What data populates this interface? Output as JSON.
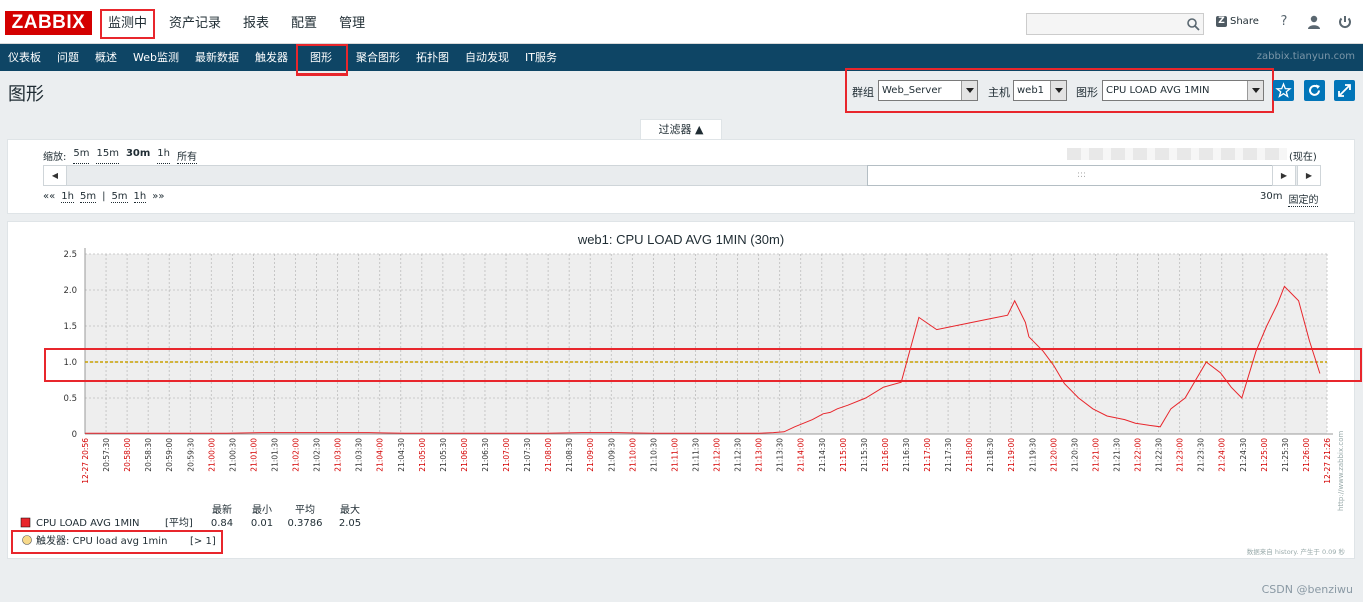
{
  "logo": "ZABBIX",
  "main_menu": [
    "监测中",
    "资产记录",
    "报表",
    "配置",
    "管理"
  ],
  "header_right": {
    "share": "Share",
    "help": "?"
  },
  "sub_menu": [
    "仪表板",
    "问题",
    "概述",
    "Web监测",
    "最新数据",
    "触发器",
    "图形",
    "聚合图形",
    "拓扑图",
    "自动发现",
    "IT服务"
  ],
  "domain": "zabbix.tianyun.com",
  "page_title": "图形",
  "selectors": {
    "group_label": "群组",
    "group_value": "Web_Server",
    "host_label": "主机",
    "host_value": "web1",
    "graph_label": "图形",
    "graph_value": "CPU LOAD AVG 1MIN"
  },
  "filter": {
    "toggle": "过滤器 ▲",
    "zoom_label": "缩放:",
    "zoom_options": [
      "5m",
      "15m",
      "30m",
      "1h",
      "所有"
    ],
    "zoom_active": "30m",
    "now": "(现在)",
    "nav_left": [
      "««",
      "1h",
      "5m",
      "|",
      "5m",
      "1h",
      "»»"
    ],
    "period": "30m",
    "fixed": "固定的"
  },
  "graph": {
    "title": "web1: CPU LOAD AVG 1MIN (30m)",
    "side_label": "http://www.zabbix.com",
    "footer_note": "数据来自 history. 产生于 0.09 秒"
  },
  "legend": {
    "headers": [
      "最新",
      "最小",
      "平均",
      "最大"
    ],
    "item_name": "CPU LOAD AVG 1MIN",
    "item_func": "[平均]",
    "item_values": [
      "0.84",
      "0.01",
      "0.3786",
      "2.05"
    ],
    "trigger_name": "触发器: CPU load avg 1min",
    "trigger_cond": "[> 1]"
  },
  "watermark": "CSDN @benziwu",
  "colors": {
    "series": "#e8262c",
    "trigger": "#c8a000",
    "accent": "#0275b8",
    "nav": "#0e4565",
    "highlight": "#e8262c"
  },
  "chart_data": {
    "type": "line",
    "title": "web1: CPU LOAD AVG 1MIN (30m)",
    "ylim": [
      0,
      2.5
    ],
    "y_ticks": [
      "0",
      "0.5",
      "1.0",
      "1.5",
      "2.0",
      "2.5"
    ],
    "x_ticks": [
      "12-27 20:56",
      "20:57:30",
      "20:58:00",
      "20:58:30",
      "20:59:00",
      "20:59:30",
      "21:00:00",
      "21:00:30",
      "21:01:00",
      "21:01:30",
      "21:02:00",
      "21:02:30",
      "21:03:00",
      "21:03:30",
      "21:04:00",
      "21:04:30",
      "21:05:00",
      "21:05:30",
      "21:06:00",
      "21:06:30",
      "21:07:00",
      "21:07:30",
      "21:08:00",
      "21:08:30",
      "21:09:00",
      "21:09:30",
      "21:10:00",
      "21:10:30",
      "21:11:00",
      "21:11:30",
      "21:12:00",
      "21:12:30",
      "21:13:00",
      "21:13:30",
      "21:14:00",
      "21:14:30",
      "21:15:00",
      "21:15:30",
      "21:16:00",
      "21:16:30",
      "21:17:00",
      "21:17:30",
      "21:18:00",
      "21:18:30",
      "21:19:00",
      "21:19:30",
      "21:20:00",
      "21:20:30",
      "21:21:00",
      "21:21:30",
      "21:22:00",
      "21:22:30",
      "21:23:00",
      "21:23:30",
      "21:24:00",
      "21:24:30",
      "21:25:00",
      "21:25:30",
      "21:26:00",
      "12-27 21:26"
    ],
    "x_ticks_red": [
      0,
      2,
      6,
      8,
      10,
      12,
      14,
      16,
      18,
      20,
      22,
      24,
      26,
      28,
      30,
      32,
      34,
      36,
      38,
      40,
      42,
      44,
      46,
      48,
      50,
      52,
      54,
      56,
      58,
      59
    ],
    "x_minutes": [
      0,
      1,
      2,
      3,
      4,
      5,
      6,
      7,
      8,
      9,
      10,
      11,
      12,
      13,
      14,
      15,
      16,
      17,
      18,
      19,
      19.4,
      19.7,
      20,
      20.5,
      20.8,
      21,
      21.2,
      21.5,
      22,
      22.5,
      23,
      23.5,
      24,
      24.5,
      25,
      25.5,
      26,
      26.2,
      26.5,
      26.6,
      27,
      27.3,
      27.6,
      28,
      28.4,
      28.8,
      29.3,
      29.6,
      30,
      30.3,
      30.6,
      31,
      31.3,
      31.6,
      32,
      32.3,
      32.6,
      33,
      33.3,
      33.6,
      33.8,
      34.2,
      34.5,
      34.8
    ],
    "values": [
      0.01,
      0.01,
      0.01,
      0.01,
      0.01,
      0.02,
      0.02,
      0.02,
      0.02,
      0.01,
      0.01,
      0.01,
      0.01,
      0.01,
      0.02,
      0.02,
      0.01,
      0.01,
      0.01,
      0.01,
      0.02,
      0.03,
      0.1,
      0.2,
      0.28,
      0.3,
      0.35,
      0.4,
      0.5,
      0.65,
      0.72,
      1.62,
      1.45,
      1.5,
      1.55,
      1.6,
      1.65,
      1.85,
      1.55,
      1.35,
      1.15,
      0.95,
      0.7,
      0.5,
      0.35,
      0.25,
      0.2,
      0.15,
      0.12,
      0.1,
      0.35,
      0.5,
      0.75,
      1.0,
      0.85,
      0.65,
      0.5,
      1.15,
      1.5,
      1.8,
      2.05,
      1.85,
      1.3,
      0.84
    ],
    "trigger_threshold": 1.0,
    "x_range": [
      0,
      35
    ]
  }
}
